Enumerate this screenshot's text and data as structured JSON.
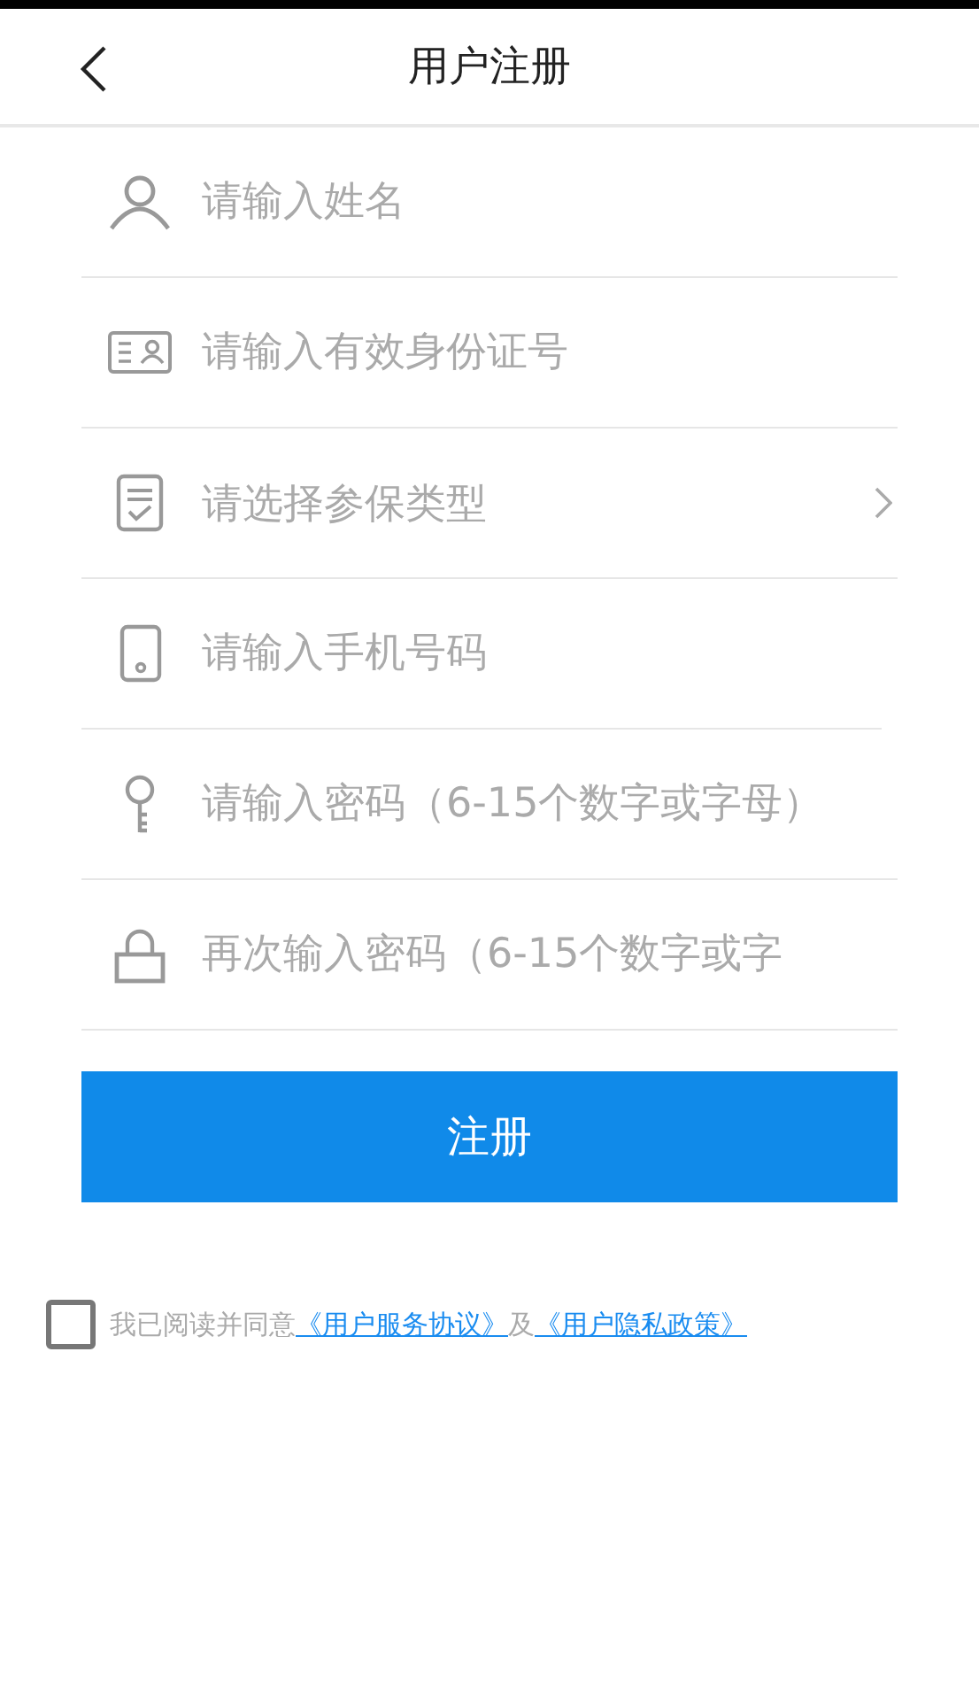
{
  "header": {
    "title": "用户注册"
  },
  "fields": [
    {
      "kind": "input",
      "placeholder": "请输入姓名"
    },
    {
      "kind": "input",
      "placeholder": "请输入有效身份证号"
    },
    {
      "kind": "select",
      "placeholder": "请选择参保类型"
    },
    {
      "kind": "input",
      "placeholder": "请输入手机号码"
    },
    {
      "kind": "input",
      "placeholder": "请输入密码（6-15个数字或字母）"
    },
    {
      "kind": "input",
      "placeholder": "再次输入密码（6-15个数字或字"
    }
  ],
  "submit": "注册",
  "agreement": {
    "checked": false,
    "text": "我已阅读并同意",
    "link_1": "《用户服务协议》",
    "joiner": "及",
    "link_2": "《用户隐私政策》"
  }
}
